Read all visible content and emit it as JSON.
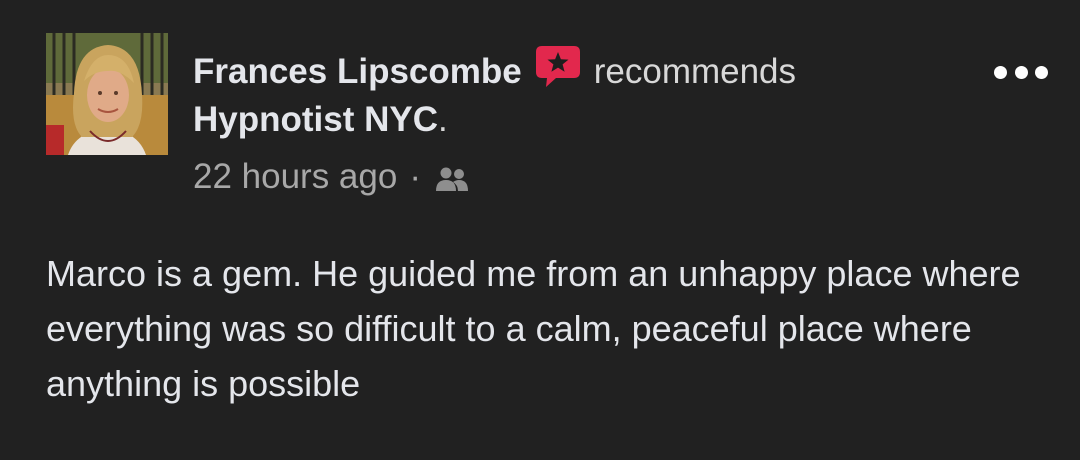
{
  "post": {
    "author": {
      "name": "Frances Lipscombe",
      "avatar_alt": "Frances Lipscombe profile photo"
    },
    "action_text": "recommends",
    "recommend_icon": "recommend-star-bubble-icon",
    "page_name": "Hypnotist NYC",
    "page_suffix": ".",
    "timestamp": "22 hours ago",
    "separator": "·",
    "audience_icon": "friends-icon",
    "more_icon": "more-options-icon",
    "body": "Marco is a gem. He guided me from an unhappy place where everything was so difficult to a calm, peaceful place where anything is possible"
  },
  "colors": {
    "background": "#212121",
    "text_primary": "#e4e6eb",
    "text_secondary": "#a8a8a8",
    "recommend_red": "#e2284d"
  }
}
